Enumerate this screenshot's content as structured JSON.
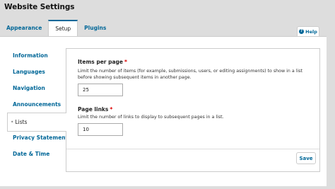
{
  "page": {
    "title": "Website Settings"
  },
  "tabs": [
    {
      "label": "Appearance"
    },
    {
      "label": "Setup"
    },
    {
      "label": "Plugins"
    }
  ],
  "help": {
    "label": "Help",
    "icon": "question-circle-icon"
  },
  "sidenav": {
    "items": [
      {
        "label": "Information"
      },
      {
        "label": "Languages"
      },
      {
        "label": "Navigation"
      },
      {
        "label": "Announcements"
      },
      {
        "label": "Lists"
      },
      {
        "label": "Privacy Statement"
      },
      {
        "label": "Date & Time"
      }
    ],
    "active_marker": "•"
  },
  "form": {
    "items_per_page": {
      "label": "Items per page",
      "required_marker": "*",
      "description": "Limit the number of items (for example, submissions, users, or editing assignments) to show in a list before showing subsequent items in another page.",
      "value": "25"
    },
    "page_links": {
      "label": "Page links",
      "required_marker": "*",
      "description": "Limit the number of links to display to subsequent pages in a list.",
      "value": "10"
    },
    "save_label": "Save"
  },
  "colors": {
    "link": "#006798",
    "required": "#dd0000",
    "background": "#dddddd"
  }
}
